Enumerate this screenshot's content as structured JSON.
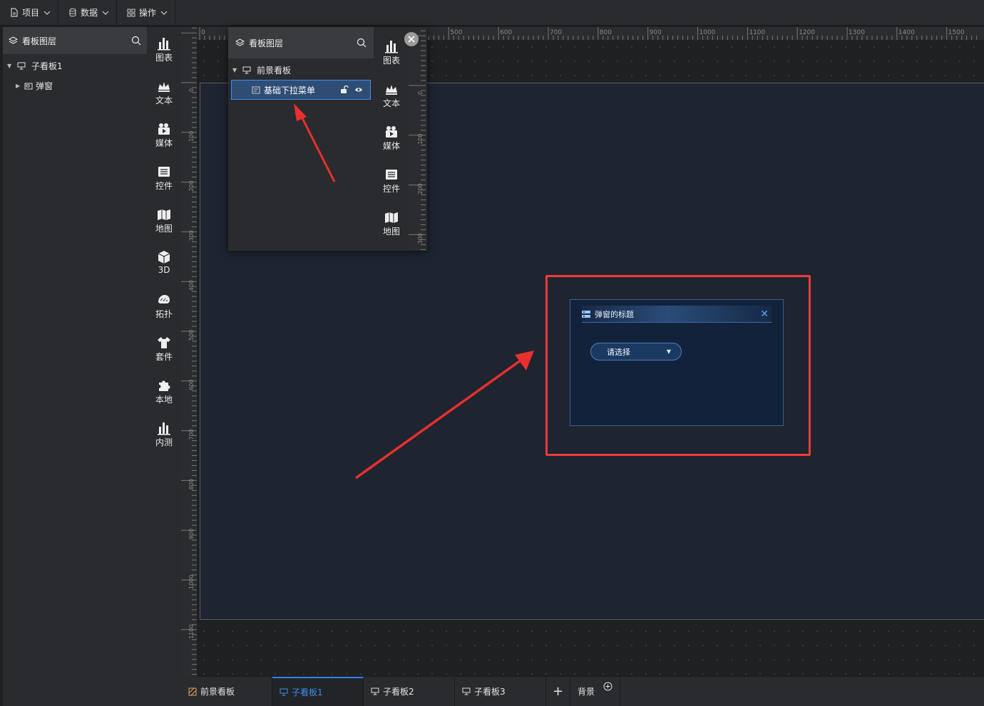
{
  "topbar": {
    "menus": [
      {
        "label": "项目",
        "icon": "file-icon"
      },
      {
        "label": "数据",
        "icon": "database-icon"
      },
      {
        "label": "操作",
        "icon": "grid-icon"
      }
    ]
  },
  "layer_panel": {
    "title": "看板图层",
    "tree": [
      {
        "label": "子看板1",
        "level": 0
      },
      {
        "label": "弹窗",
        "level": 1
      }
    ]
  },
  "toolbox": {
    "items": [
      {
        "label": "图表",
        "icon": "bar-chart-icon"
      },
      {
        "label": "文本",
        "icon": "crown-text-icon"
      },
      {
        "label": "媒体",
        "icon": "media-icon"
      },
      {
        "label": "控件",
        "icon": "control-icon"
      },
      {
        "label": "地图",
        "icon": "map-icon"
      },
      {
        "label": "3D",
        "icon": "cube-icon"
      },
      {
        "label": "拓扑",
        "icon": "topology-icon"
      },
      {
        "label": "套件",
        "icon": "shirt-icon"
      },
      {
        "label": "本地",
        "icon": "puzzle-icon"
      },
      {
        "label": "内测",
        "icon": "bar-chart-icon"
      }
    ]
  },
  "rulers": {
    "top_ticks": [
      "0",
      "500",
      "600",
      "700",
      "800",
      "900",
      "1000",
      "1100",
      "1200",
      "1300",
      "1400",
      "1500"
    ],
    "left_ticks": [
      "0",
      "100",
      "200",
      "300",
      "400",
      "500",
      "600",
      "700",
      "800",
      "900",
      "1000",
      "1100"
    ]
  },
  "float_window": {
    "title": "看板图层",
    "tree": [
      {
        "label": "前景看板"
      },
      {
        "label": "基础下拉菜单",
        "selected": true
      }
    ],
    "tools": [
      {
        "label": "图表"
      },
      {
        "label": "文本"
      },
      {
        "label": "媒体"
      },
      {
        "label": "控件"
      },
      {
        "label": "地图"
      }
    ],
    "ruler_ticks": [
      "0",
      "100",
      "200",
      "300"
    ]
  },
  "popup": {
    "title": "弹窗的标题",
    "select_placeholder": "请选择"
  },
  "tabs": {
    "items": [
      {
        "label": "前景看板",
        "active": false
      },
      {
        "label": "子看板1",
        "active": true
      },
      {
        "label": "子看板2",
        "active": false
      },
      {
        "label": "子看板3",
        "active": false
      }
    ],
    "add_label": "+",
    "background_label": "背景"
  },
  "colors": {
    "accent": "#2f80ed",
    "highlight_box": "#f03a3a",
    "annotation_arrow": "#e8302e"
  }
}
